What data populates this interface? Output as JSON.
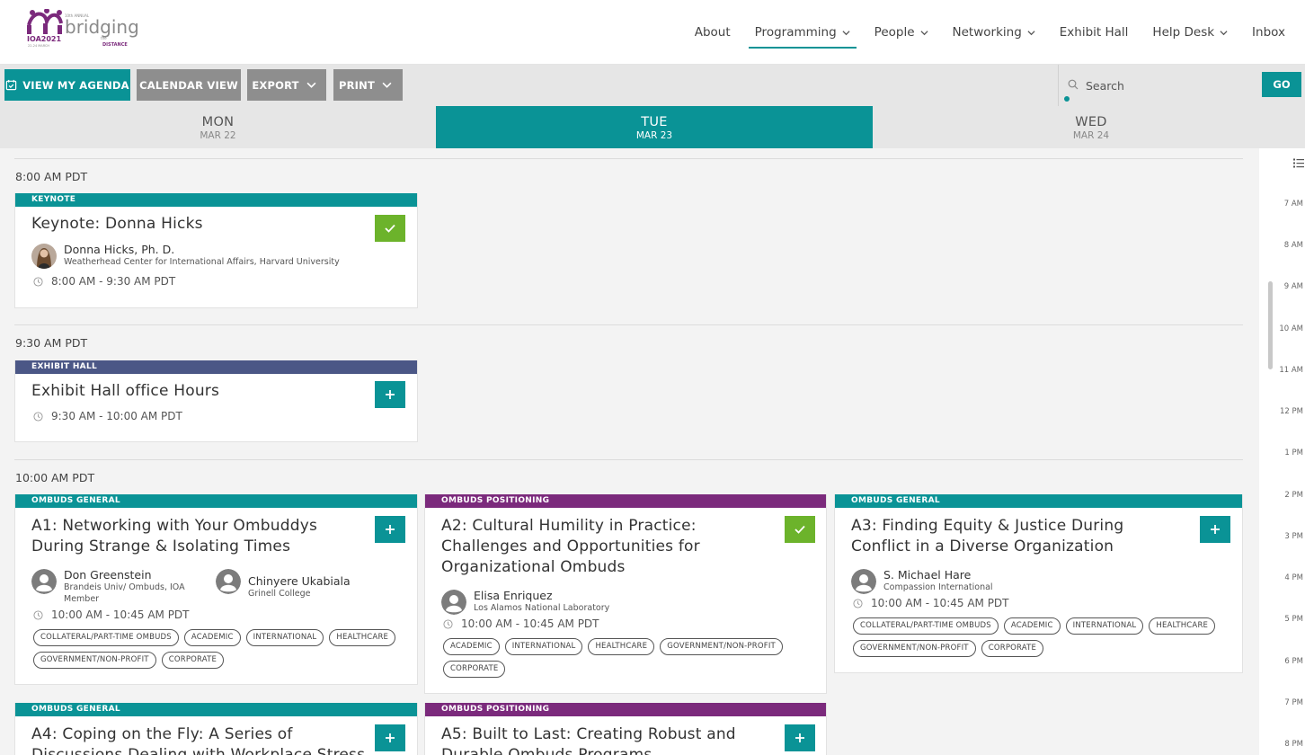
{
  "header": {
    "logo": {
      "line_small": "10th ANNUAL",
      "word": "bridging",
      "the": "the",
      "distance": "DISTANCE",
      "org": "IOA2021",
      "dates": "22-24 MARCH"
    },
    "nav": [
      {
        "label": "About",
        "dropdown": false
      },
      {
        "label": "Programming",
        "dropdown": true,
        "active": true
      },
      {
        "label": "People",
        "dropdown": true
      },
      {
        "label": "Networking",
        "dropdown": true
      },
      {
        "label": "Exhibit Hall",
        "dropdown": false
      },
      {
        "label": "Help Desk",
        "dropdown": true
      },
      {
        "label": "Inbox",
        "dropdown": false
      }
    ]
  },
  "toolbar": {
    "view_agenda": "VIEW MY AGENDA",
    "calendar_view": "CALENDAR VIEW",
    "export": "EXPORT",
    "print": "PRINT",
    "search_placeholder": "Search",
    "go": "GO"
  },
  "days": [
    {
      "name": "MON",
      "date": "MAR 22",
      "active": false
    },
    {
      "name": "TUE",
      "date": "MAR 23",
      "active": true
    },
    {
      "name": "WED",
      "date": "MAR 24",
      "active": false
    }
  ],
  "slots": [
    {
      "time": "8:00 AM PDT",
      "sessions": [
        {
          "category": "KEYNOTE",
          "title": "Keynote: Donna Hicks",
          "added": true,
          "speakers": [
            {
              "name": "Donna Hicks, Ph. D.",
              "affiliation": "Weatherhead Center for International Affairs, Harvard University"
            }
          ],
          "time": "8:00 AM - 9:30 AM PDT",
          "tags": []
        }
      ]
    },
    {
      "time": "9:30 AM PDT",
      "sessions": [
        {
          "category": "EXHIBIT HALL",
          "title": "Exhibit Hall office Hours",
          "added": false,
          "speakers": [],
          "time": "9:30 AM - 10:00 AM PDT",
          "tags": []
        }
      ]
    },
    {
      "time": "10:00 AM PDT",
      "sessions": [
        {
          "category": "OMBUDS GENERAL",
          "title_lines": [
            "A1: Networking with Your Ombuddys",
            "During Strange & Isolating Times"
          ],
          "added": false,
          "speakers": [
            {
              "name": "Don Greenstein",
              "affiliation_lines": [
                "Brandeis Univ/ Ombuds, IOA",
                "Member"
              ]
            },
            {
              "name": "Chinyere Ukabiala",
              "affiliation": "Grinell College"
            }
          ],
          "time": "10:00 AM - 10:45 AM PDT",
          "tags": [
            "COLLATERAL/PART-TIME OMBUDS",
            "ACADEMIC",
            "INTERNATIONAL",
            "HEALTHCARE",
            "GOVERNMENT/NON-PROFIT",
            "CORPORATE"
          ]
        },
        {
          "category": "OMBUDS POSITIONING",
          "title_lines": [
            "A2: Cultural Humility in Practice:",
            "Challenges and Opportunities for",
            "Organizational Ombuds"
          ],
          "added": true,
          "speakers": [
            {
              "name": "Elisa Enriquez",
              "affiliation": "Los Alamos National Laboratory"
            }
          ],
          "time": "10:00 AM - 10:45 AM PDT",
          "tags": [
            "ACADEMIC",
            "INTERNATIONAL",
            "HEALTHCARE",
            "GOVERNMENT/NON-PROFIT",
            "CORPORATE"
          ]
        },
        {
          "category": "OMBUDS GENERAL",
          "title_lines": [
            "A3: Finding Equity & Justice During",
            "Conflict in a Diverse Organization"
          ],
          "added": false,
          "speakers": [
            {
              "name": "S. Michael Hare",
              "affiliation": "Compassion International"
            }
          ],
          "time": "10:00 AM - 10:45 AM PDT",
          "tags": [
            "COLLATERAL/PART-TIME OMBUDS",
            "ACADEMIC",
            "INTERNATIONAL",
            "HEALTHCARE",
            "GOVERNMENT/NON-PROFIT",
            "CORPORATE"
          ]
        },
        {
          "category": "OMBUDS GENERAL",
          "title_lines": [
            "A4: Coping on the Fly: A Series of",
            "Discussions Dealing with Workplace Stress"
          ],
          "added": false
        },
        {
          "category": "OMBUDS POSITIONING",
          "title_lines": [
            "A5: Built to Last: Creating Robust and",
            "Durable Ombuds Programs"
          ],
          "added": false
        }
      ]
    }
  ],
  "timeline_hours": [
    "7 AM",
    "8 AM",
    "9 AM",
    "10 AM",
    "11 AM",
    "12 PM",
    "1 PM",
    "2 PM",
    "3 PM",
    "4 PM",
    "5 PM",
    "6 PM",
    "7 PM",
    "8 PM"
  ],
  "colors": {
    "teal": "#0a9396",
    "navy": "#4b5786",
    "purple": "#7b2a7c",
    "added_green": "#6cb32b",
    "logo_purple": "#7b2a7c",
    "logo_grey": "#8a8a8a"
  }
}
